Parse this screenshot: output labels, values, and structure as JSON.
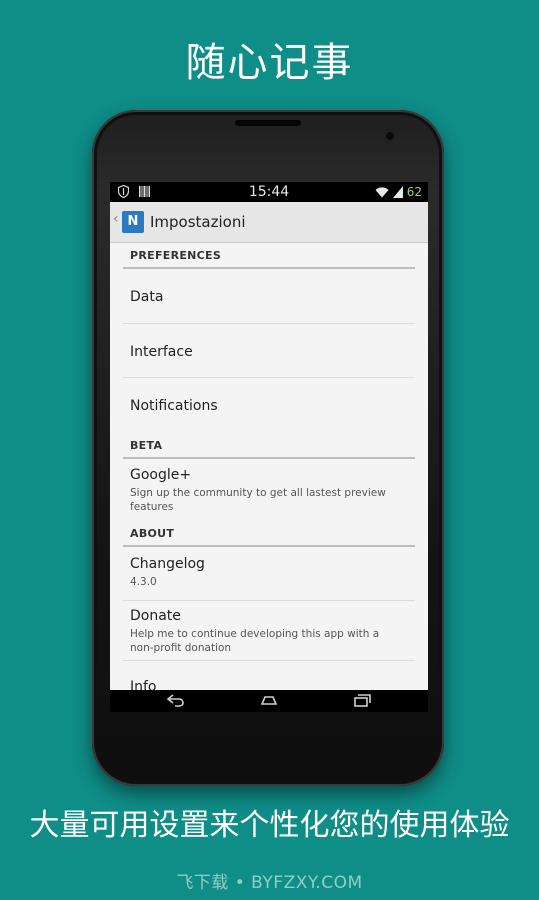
{
  "promo": {
    "headline": "随心记事",
    "caption": "大量可用设置来个性化您的使用体验",
    "watermark": "飞下载 • BYFZXY.COM"
  },
  "statusbar": {
    "time": "15:44",
    "battery": "62",
    "icons": [
      "shield-icon",
      "barcode-icon",
      "wifi-icon",
      "signal-icon"
    ]
  },
  "actionbar": {
    "title": "Impostazioni",
    "app_icon_letter": "N"
  },
  "sections": {
    "preferences": "PREFERENCES",
    "beta": "BETA",
    "about": "ABOUT"
  },
  "items": {
    "data": {
      "title": "Data"
    },
    "interface": {
      "title": "Interface"
    },
    "notifications": {
      "title": "Notifications"
    },
    "google": {
      "title": "Google+",
      "summary": "Sign up the community to get all lastest preview features"
    },
    "changelog": {
      "title": "Changelog",
      "summary": "4.3.0"
    },
    "donate": {
      "title": "Donate",
      "summary": "Help me to continue developing this app with a non-profit donation"
    },
    "info": {
      "title": "Info"
    }
  },
  "navbar": {
    "back": "back-icon",
    "home": "home-icon",
    "recents": "recents-icon"
  },
  "colors": {
    "background": "#0f8d87",
    "app_icon": "#2b79c2"
  }
}
